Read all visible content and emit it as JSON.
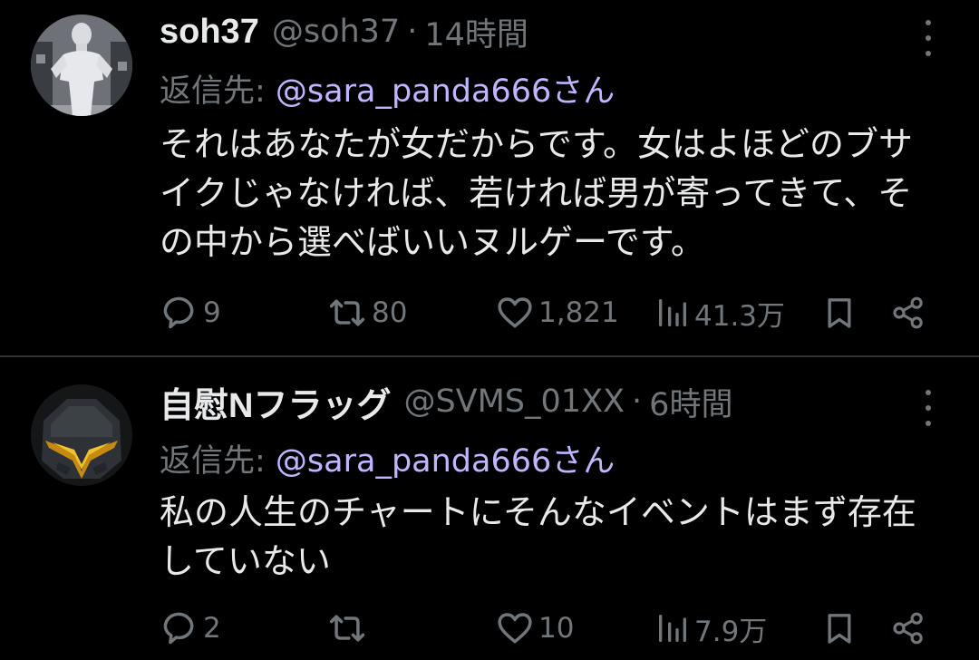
{
  "colors": {
    "background": "#000000",
    "text_primary": "#e7e9ea",
    "text_secondary": "#71767b",
    "mention": "#c3b4ff",
    "divider": "#2f3336"
  },
  "tweets": [
    {
      "display_name": "soh37",
      "handle": "@soh37",
      "separator": "·",
      "time": "14時間",
      "reply_prefix": "返信先: ",
      "reply_target": "@sara_panda666さん",
      "text": "それはあなたが女だからです。女はよほどのブサイクじゃなければ、若ければ男が寄ってきて、その中から選べばいいヌルゲーです。",
      "replies": "9",
      "retweets": "80",
      "likes": "1,821",
      "views": "41.3万",
      "avatar_icon": "person-avatar-icon"
    },
    {
      "display_name": "自慰Nフラッグ",
      "handle": "@SVMS_01XX",
      "separator": "·",
      "time": "6時間",
      "reply_prefix": "返信先: ",
      "reply_target": "@sara_panda666さん",
      "text": "私の人生のチャートにそんなイベントはまず存在していない",
      "replies": "2",
      "retweets": "",
      "likes": "10",
      "views": "7.9万",
      "avatar_icon": "robot-head-avatar-icon"
    }
  ]
}
